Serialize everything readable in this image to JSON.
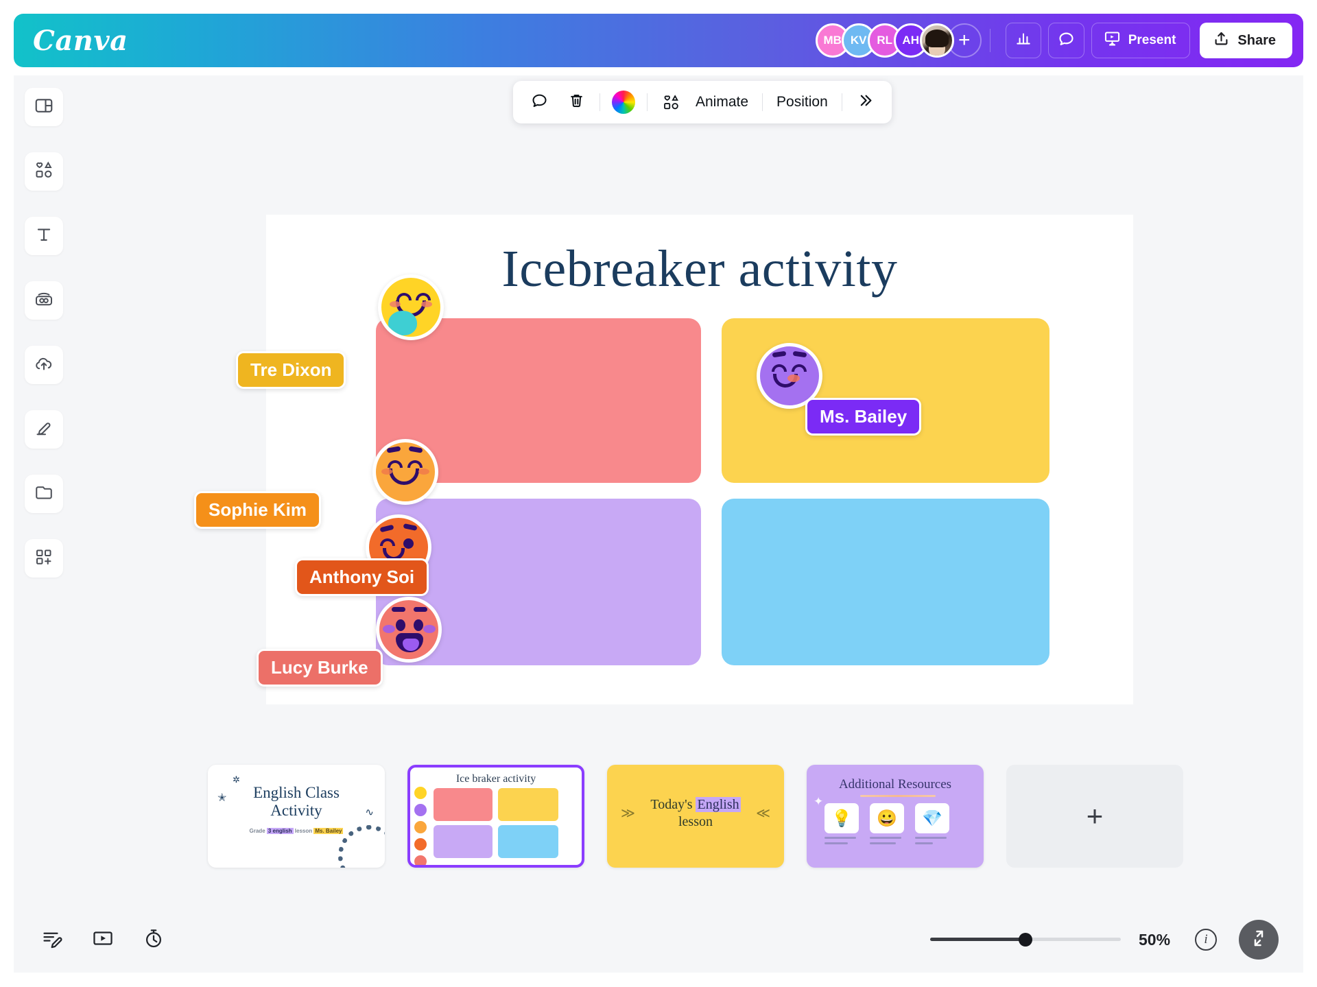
{
  "app": {
    "logo": "Canva"
  },
  "topbar": {
    "avatars": [
      {
        "initials": "MB",
        "color": "#F979D4",
        "name": "avatar-mb"
      },
      {
        "initials": "KV",
        "color": "#6EB9F2",
        "name": "avatar-kv"
      },
      {
        "initials": "RL",
        "color": "#E45BE0",
        "name": "avatar-rl"
      },
      {
        "initials": "AH",
        "color": "#7B2BF5",
        "name": "avatar-ah"
      },
      {
        "initials": "",
        "color": "#c3b1a2",
        "name": "avatar-photo"
      }
    ],
    "add_collaborator": "+",
    "insights_icon": "bar-chart-icon",
    "comment_icon": "comment-bubble-icon",
    "present_label": "Present",
    "present_icon": "presentation-screen-icon",
    "share_label": "Share",
    "share_icon": "upload-icon"
  },
  "sidebar": {
    "items": [
      {
        "label": "Design",
        "icon": "design-panel-icon"
      },
      {
        "label": "Elements",
        "icon": "shapes-elements-icon"
      },
      {
        "label": "Text",
        "icon": "text-t-icon"
      },
      {
        "label": "Brand",
        "icon": "brand-kit-icon"
      },
      {
        "label": "Uploads",
        "icon": "cloud-upload-icon"
      },
      {
        "label": "Draw",
        "icon": "pen-draw-icon"
      },
      {
        "label": "Projects",
        "icon": "folder-icon"
      },
      {
        "label": "Apps",
        "icon": "apps-grid-plus-icon"
      }
    ]
  },
  "float_toolbar": {
    "comment_icon": "comment-bubble-icon",
    "delete_icon": "trash-icon",
    "color_icon": "color-wheel-icon",
    "animate_icon": "shapes-icon",
    "animate_label": "Animate",
    "position_label": "Position",
    "more_label": "»"
  },
  "slide": {
    "title": "Icebreaker activity",
    "boxes": [
      {
        "name": "box-pink",
        "color": "#F8898C"
      },
      {
        "name": "box-yellow",
        "color": "#FCD34F"
      },
      {
        "name": "box-purple",
        "color": "#C8A9F5"
      },
      {
        "name": "box-blue",
        "color": "#7ED1F7"
      }
    ]
  },
  "collaborators": [
    {
      "name": "Tre Dixon",
      "tag_color": "#EFB520",
      "face_color": "#FFD426",
      "cursor_color": "#FCD34F"
    },
    {
      "name": "Ms. Bailey",
      "tag_color": "#7B2BF5",
      "face_color": "#A471F0",
      "cursor_color": "#7B2BF5"
    },
    {
      "name": "Sophie Kim",
      "tag_color": "#F59019",
      "face_color": "#FAA63C",
      "cursor_color": "#FCD34F"
    },
    {
      "name": "Anthony Soi",
      "tag_color": "#E2561A",
      "face_color": "#F26B2A",
      "cursor_color": "#F26B2A"
    },
    {
      "name": "Lucy Burke",
      "tag_color": "#EC7068",
      "face_color": "#F2766C",
      "cursor_color": "#FFFFFF"
    }
  ],
  "thumbnails": {
    "slide1": {
      "title_line1": "English Class",
      "title_line2": "Activity",
      "sub_pre": "Grade ",
      "sub_hl1": "3 english",
      "sub_mid": " lesson ",
      "sub_hl2": "Ms. Bailey"
    },
    "slide2": {
      "title": "Ice braker activity",
      "faces": [
        "#FFD426",
        "#A471F0",
        "#FAA63C",
        "#F26B2A",
        "#F2766C"
      ],
      "boxes": [
        "#F8898C",
        "#FCD34F",
        "#C8A9F5",
        "#7ED1F7"
      ]
    },
    "slide3": {
      "text_pre": "Today's ",
      "text_hl": "English",
      "text_post": "lesson"
    },
    "slide4": {
      "title": "Additional Resources",
      "cards": [
        {
          "icon": "💡"
        },
        {
          "icon": "😀"
        },
        {
          "icon": "💎"
        }
      ]
    },
    "add_slide_label": "+"
  },
  "bottombar": {
    "notes_icon": "notes-edit-icon",
    "play_icon": "play-video-icon",
    "timer_icon": "stopwatch-timer-icon",
    "zoom_value": "50%",
    "zoom_percent": 50,
    "info_label": "i",
    "fullscreen_icon": "collapse-expand-icon"
  }
}
